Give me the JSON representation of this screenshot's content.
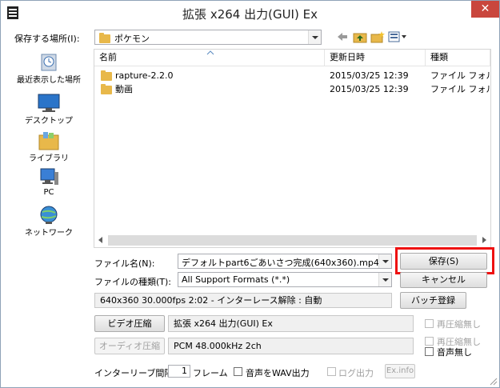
{
  "window": {
    "title": "拡張 x264 出力(GUI) Ex",
    "close_symbol": "✕"
  },
  "location": {
    "label": "保存する場所(I):",
    "value": "ポケモン"
  },
  "places": [
    {
      "label": "最近表示した場所",
      "icon": "recent-places-icon"
    },
    {
      "label": "デスクトップ",
      "icon": "desktop-icon"
    },
    {
      "label": "ライブラリ",
      "icon": "libraries-icon"
    },
    {
      "label": "PC",
      "icon": "pc-icon"
    },
    {
      "label": "ネットワーク",
      "icon": "network-icon"
    }
  ],
  "filelist": {
    "columns": [
      "名前",
      "更新日時",
      "種類"
    ],
    "rows": [
      {
        "name": "rapture-2.2.0",
        "date": "2015/03/25 12:39",
        "type": "ファイル フォルダー"
      },
      {
        "name": "動画",
        "date": "2015/03/25 12:39",
        "type": "ファイル フォルダー"
      }
    ]
  },
  "filename": {
    "label": "ファイル名(N):",
    "value": "デフォルトpart6ごあいさつ完成(640x360).mp4"
  },
  "filetype": {
    "label": "ファイルの種類(T):",
    "value": "All Support Formats (*.*)"
  },
  "buttons": {
    "save": "保存(S)",
    "cancel": "キャンセル",
    "batch": "バッチ登録",
    "video": "ビデオ圧縮",
    "audio": "オーディオ圧縮",
    "exinfo": "Ex.info"
  },
  "info": "640x360  30.000fps  2:02  -  インターレース解除 : 自動",
  "video_codec": "拡張 x264 出力(GUI) Ex",
  "audio_codec": "PCM 48.000kHz 2ch",
  "checkboxes": {
    "video_recompress": "再圧縮無し",
    "audio_recompress": "再圧縮無し",
    "no_audio": "音声無し",
    "wav_out": "音声をWAV出力",
    "log_out": "ログ出力"
  },
  "interleave": {
    "label": "インターリーブ間隔 :",
    "value": "1",
    "unit": "フレーム"
  },
  "colors": {
    "highlight": "#e11111",
    "close": "#c9463d",
    "folder": "#e8b84a"
  }
}
